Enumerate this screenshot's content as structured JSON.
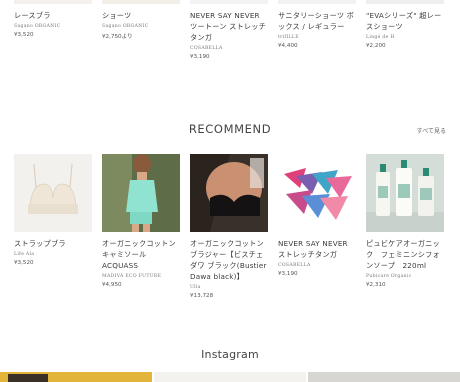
{
  "top_products": [
    {
      "name": "レースブラ",
      "brand": "Sagano ORGANIC",
      "price": "¥3,520",
      "image": "lace-bra-photo"
    },
    {
      "name": "ショーツ",
      "brand": "Sagano ORGANIC",
      "price": "¥2,750より",
      "image": "shorts-photo"
    },
    {
      "name": "NEVER SAY NEVER ツートーン ストレッチタンガ",
      "brand": "COSABELLA",
      "price": "¥3,190",
      "image": "two-tone-tanga-photo"
    },
    {
      "name": "サニタリーショーツ ボックス / レギュラー",
      "brand": "trifILLE",
      "price": "¥4,400",
      "image": "sanitary-shorts-photo"
    },
    {
      "name": "\"EVAシリーズ\" 超レースショーツ",
      "brand": "Lingé de H",
      "price": "¥2,200",
      "image": "eva-lace-shorts-photo"
    }
  ],
  "recommend": {
    "title": "RECOMMEND",
    "see_all": "すべて見る",
    "items": [
      {
        "name": "ストラップブラ",
        "brand": "Life Ala",
        "price": "¥3,520",
        "image": "strap-bra-photo"
      },
      {
        "name": "オーガニックコットン キャミソール　ACQUASS",
        "brand": "MADIVA ECO FUTURE",
        "price": "¥4,950",
        "image": "mint-camisole-photo"
      },
      {
        "name": "オーガニックコットン ブラジャー【ビスチェダワ ブラック(Bustier Dawa black)】",
        "brand": "Ulla",
        "price": "¥13,728",
        "image": "black-bustier-photo"
      },
      {
        "name": "NEVER SAY NEVER ストレッチタンガ",
        "brand": "COSABELLA",
        "price": "¥3,190",
        "image": "colorful-tangas-photo"
      },
      {
        "name": "ピュビケアオーガニック　フェミニンシフォンソープ　220ml",
        "brand": "Pubicare Organic",
        "price": "¥2,310",
        "image": "feminine-soap-bottles-photo"
      }
    ]
  },
  "instagram": {
    "title": "Instagram"
  }
}
